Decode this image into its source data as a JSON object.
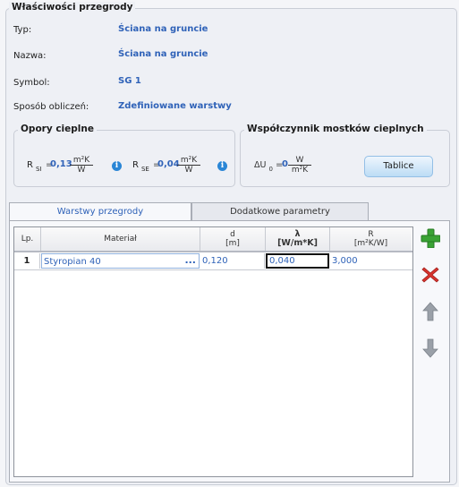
{
  "panel": {
    "title": "Właściwości przegrody"
  },
  "properties": [
    {
      "label": "Typ:",
      "value": "Ściana na gruncie"
    },
    {
      "label": "Nazwa:",
      "value": "Ściana na gruncie"
    },
    {
      "label": "Symbol:",
      "value": "SG 1"
    },
    {
      "label": "Sposób obliczeń:",
      "value": "Zdefiniowane warstwy"
    }
  ],
  "resistances": {
    "title": "Opory cieplne",
    "rsi": {
      "symbol": "R",
      "subscript": "SI",
      "value": "0,13",
      "unit_num": "m²K",
      "unit_den": "W"
    },
    "rse": {
      "symbol": "R",
      "subscript": "SE",
      "value": "0,04",
      "unit_num": "m²K",
      "unit_den": "W"
    }
  },
  "bridges": {
    "title": "Współczynnik mostków cieplnych",
    "symbol": "ΔU",
    "subscript": "0",
    "value": "0",
    "unit_num": "W",
    "unit_den": "m²K",
    "button_label": "Tablice"
  },
  "tabs": [
    {
      "label": "Warstwy przegrody",
      "active": true
    },
    {
      "label": "Dodatkowe parametry",
      "active": false
    }
  ],
  "table": {
    "columns": [
      {
        "key": "lp",
        "top": "Lp.",
        "bottom": ""
      },
      {
        "key": "material",
        "top": "Materiał",
        "bottom": ""
      },
      {
        "key": "d",
        "top": "d",
        "bottom": "[m]"
      },
      {
        "key": "lambda",
        "top": "λ",
        "bottom": "[W/m*K]"
      },
      {
        "key": "r",
        "top": "R",
        "bottom": "[m²K/W]"
      }
    ],
    "rows": [
      {
        "lp": "1",
        "material": "Styropian 40",
        "ellipsis": "...",
        "d": "0,120",
        "lambda": "0,040",
        "r": "3,000"
      }
    ]
  },
  "side_buttons": [
    "plus-icon",
    "delete-x-icon",
    "arrow-up-icon",
    "arrow-down-icon"
  ],
  "colors": {
    "accent_blue": "#2f62b8",
    "add_green": "#3aa335",
    "delete_red": "#d8332d",
    "disabled_gray": "#9aa0a8"
  }
}
